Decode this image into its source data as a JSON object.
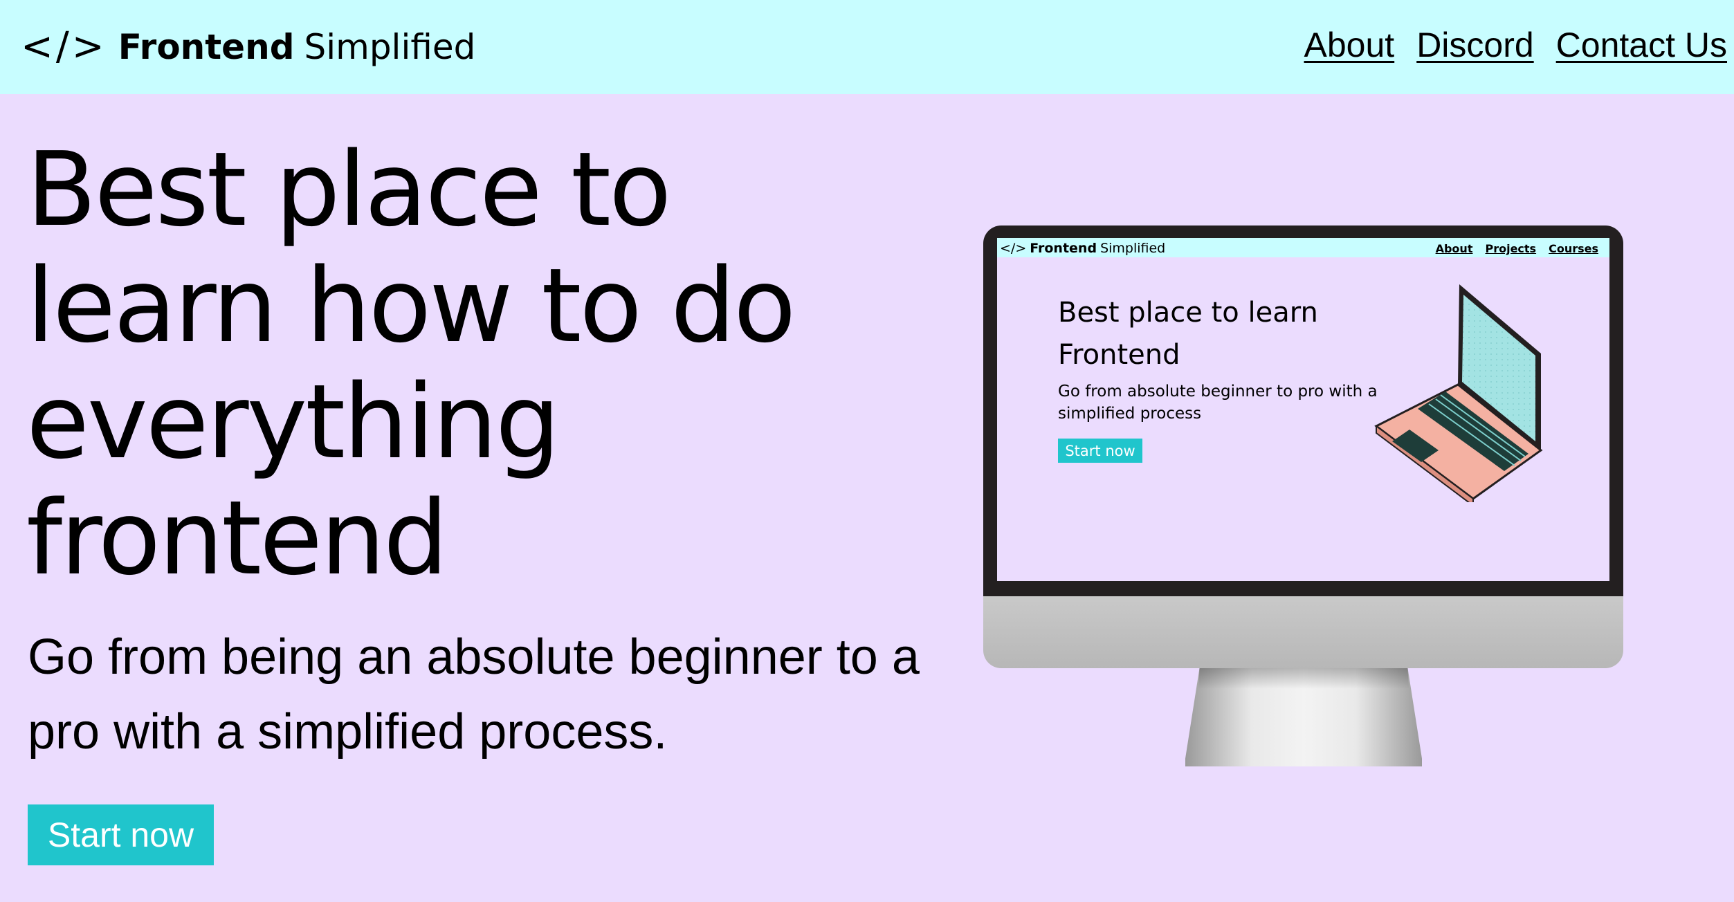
{
  "nav": {
    "logo_icon": "</>",
    "logo_bold": "Frontend",
    "logo_light": "Simplified",
    "links": [
      {
        "label": "About"
      },
      {
        "label": "Discord"
      },
      {
        "label": "Contact Us"
      }
    ]
  },
  "hero": {
    "title": "Best place to learn how to do everything frontend",
    "subtitle": "Go from being an absolute beginner to a pro with a simplified process.",
    "cta_label": "Start now"
  },
  "illustration": {
    "logo_icon": "</>",
    "logo_bold": "Frontend",
    "logo_light": "Simplified",
    "links": [
      {
        "label": "About"
      },
      {
        "label": "Projects"
      },
      {
        "label": "Courses"
      }
    ],
    "title": "Best place to learn Frontend",
    "subtitle": "Go from absolute beginner to pro with a simplified process",
    "cta_label": "Start now"
  },
  "colors": {
    "nav_bg": "#c8fdff",
    "page_bg": "#ebdcfe",
    "accent": "#20c5cc"
  }
}
